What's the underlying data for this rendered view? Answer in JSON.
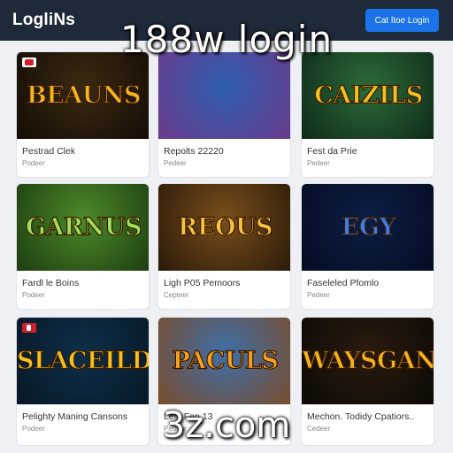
{
  "header": {
    "logo": "LogliNs",
    "cta_label": "Cat ltoe Login"
  },
  "overlay": {
    "title": "188w login",
    "footer": "3z.com"
  },
  "games": [
    {
      "title": "BEAUNS",
      "name": "Pestrad Clek",
      "provider": "Podeer",
      "colors": [
        "#3a2a12",
        "#140c05"
      ],
      "text": "#f5b51c"
    },
    {
      "title": "",
      "name": "Repolts 22220",
      "provider": "Pedeer",
      "colors": [
        "#2f5fb0",
        "#6b3a8c"
      ],
      "text": "#ffffff"
    },
    {
      "title": "CAIZILS",
      "name": "Fest da Prie",
      "provider": "Pedeer",
      "colors": [
        "#2c6b3a",
        "#0f2a18"
      ],
      "text": "#f4c21f"
    },
    {
      "title": "GARNUS",
      "name": "Fardl le Boins",
      "provider": "Podeer",
      "colors": [
        "#4c8a2a",
        "#1d3d10"
      ],
      "text": "#9fe05a"
    },
    {
      "title": "REOUS",
      "name": "Ligh P05 Pemoors",
      "provider": "Cepteer",
      "colors": [
        "#7a4e1c",
        "#2a1a08"
      ],
      "text": "#f6c33a"
    },
    {
      "title": "EGY",
      "name": "Faseleled Pfomlo",
      "provider": "Pedeer",
      "colors": [
        "#0c1e45",
        "#050c22"
      ],
      "text": "#3d7ee8"
    },
    {
      "title": "SLACEILDS",
      "name": "Pelighty Maning Cansons",
      "provider": "Podeer",
      "colors": [
        "#0d2f4a",
        "#081826"
      ],
      "text": "#f4c21f"
    },
    {
      "title": "PACULS",
      "name": "Lest Fen 13",
      "provider": "Pedeer",
      "colors": [
        "#3e6fa8",
        "#7a4b2a"
      ],
      "text": "#f6a21c"
    },
    {
      "title": "WAYSGANS",
      "name": "Mechon. Todidy Cpatiors..",
      "provider": "Cedeer",
      "colors": [
        "#2a1b0e",
        "#0d0906"
      ],
      "text": "#f3b21b"
    }
  ]
}
